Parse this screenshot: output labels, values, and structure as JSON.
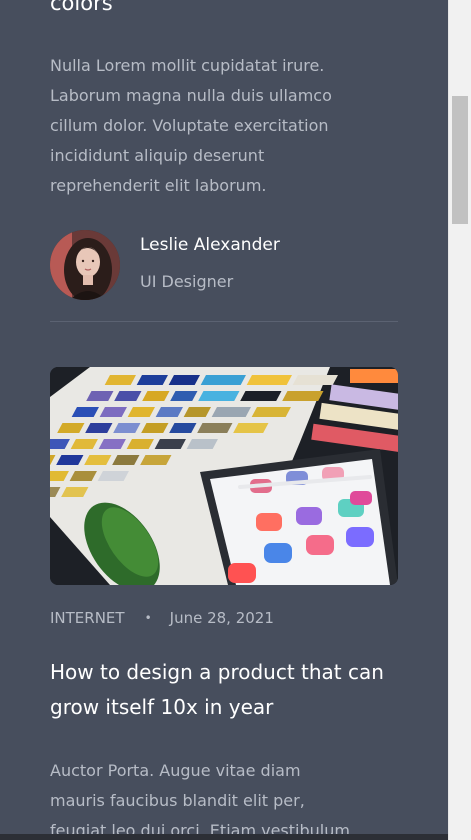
{
  "post_top": {
    "title_tail": "colors",
    "excerpt": "Nulla Lorem mollit cupidatat irure. Laborum magna nulla duis ullamco cillum dolor. Voluptate exercitation incididunt aliquip deserunt reprehenderit elit laborum.",
    "author": {
      "name": "Leslie Alexander",
      "role": "UI Designer"
    }
  },
  "post_next": {
    "category": "INTERNET",
    "separator": "•",
    "date": "June 28, 2021",
    "title": "How to design a product that can grow itself 10x in year",
    "excerpt": "Auctor Porta. Augue vitae diam mauris faucibus blandit elit per, feugiat leo dui orci. Etiam vestibulum. Nostra netus"
  },
  "colors": {
    "background": "#474e5d",
    "text_primary": "#ffffff",
    "text_muted": "#b7bcc6",
    "divider": "#5b6272"
  }
}
